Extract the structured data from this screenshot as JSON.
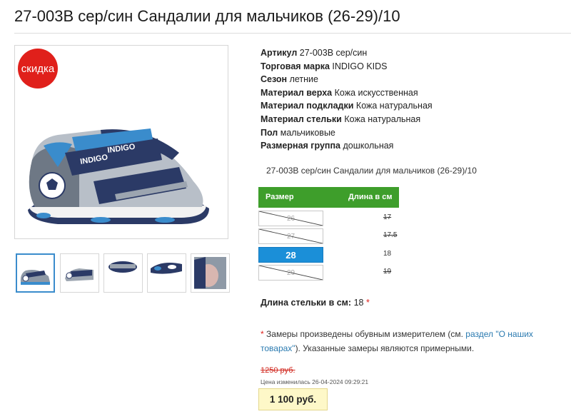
{
  "product": {
    "title": "27-003B сер/син Сандалии для мальчиков (26-29)/10",
    "sale_badge": "скидка",
    "subtitle": "27-003B сер/син Сандалии для мальчиков (26-29)/10"
  },
  "specs": [
    {
      "label": "Артикул",
      "value": "27-003B сер/син"
    },
    {
      "label": "Торговая марка",
      "value": "INDIGO KIDS"
    },
    {
      "label": "Сезон",
      "value": "летние"
    },
    {
      "label": "Материал верха",
      "value": "Кожа искусственная"
    },
    {
      "label": "Материал подкладки",
      "value": "Кожа натуральная"
    },
    {
      "label": "Материал стельки",
      "value": "Кожа натуральная"
    },
    {
      "label": "Пол",
      "value": "мальчиковые"
    },
    {
      "label": "Размерная группа",
      "value": "дошкольная"
    }
  ],
  "sizes": {
    "header_size": "Размер",
    "header_length": "Длина в см",
    "rows": [
      {
        "size": "26",
        "length": "17",
        "available": false,
        "selected": false
      },
      {
        "size": "27",
        "length": "17.5",
        "available": false,
        "selected": false
      },
      {
        "size": "28",
        "length": "18",
        "available": true,
        "selected": true
      },
      {
        "size": "29",
        "length": "19",
        "available": false,
        "selected": false
      }
    ]
  },
  "insole": {
    "label": "Длина стельки в см:",
    "value": "18",
    "star": "*"
  },
  "note": {
    "star": "*",
    "text_before": "Замеры произведены обувным измерителем (см. ",
    "link": "раздел \"О наших товарах\"",
    "text_after": "). Указанные замеры являются примерными."
  },
  "price": {
    "old": "1250 руб.",
    "changed": "Цена изменилась 26-04-2024 09:29:21",
    "current": "1 100 руб."
  },
  "thumbnails": [
    "sandal-side-view",
    "sandal-top-view",
    "sandal-back-view",
    "sandal-sole-view",
    "sandal-inside-view"
  ],
  "colors": {
    "accent_green": "#3e9e2b",
    "selected_blue": "#1b8fd8",
    "sale_red": "#e0201b",
    "price_bg": "#fef8c8"
  }
}
